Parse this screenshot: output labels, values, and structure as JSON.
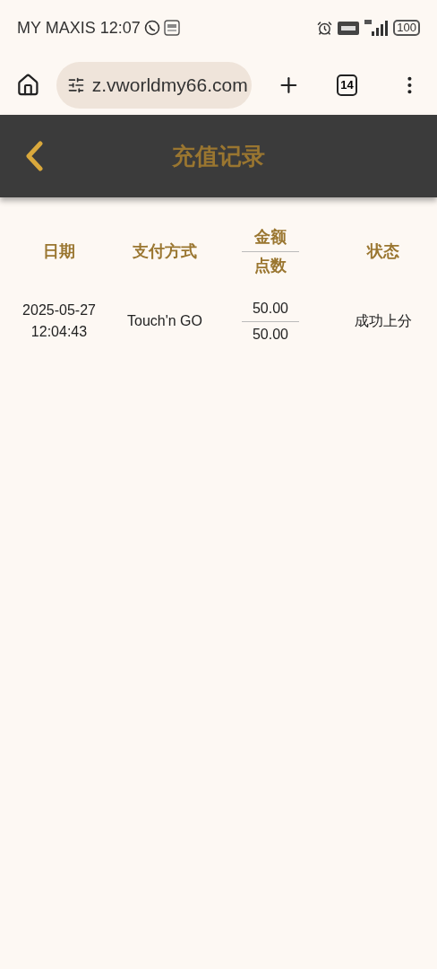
{
  "status_bar": {
    "carrier_time": "MY MAXIS 12:07",
    "battery": "100"
  },
  "browser": {
    "url": "z.vworldmy66.com",
    "tab_count": "14"
  },
  "header": {
    "title": "充值记录"
  },
  "table": {
    "columns": [
      {
        "kind": "single",
        "label": "日期"
      },
      {
        "kind": "single",
        "label": "支付方式"
      },
      {
        "kind": "split",
        "top": "金额",
        "bottom": "点数"
      },
      {
        "kind": "single",
        "label": "状态"
      }
    ],
    "rows": [
      {
        "date": "2025-05-27",
        "time": "12:04:43",
        "method": "Touch'n GO",
        "amount": "50.00",
        "points": "50.00",
        "status": "成功上分"
      }
    ]
  }
}
